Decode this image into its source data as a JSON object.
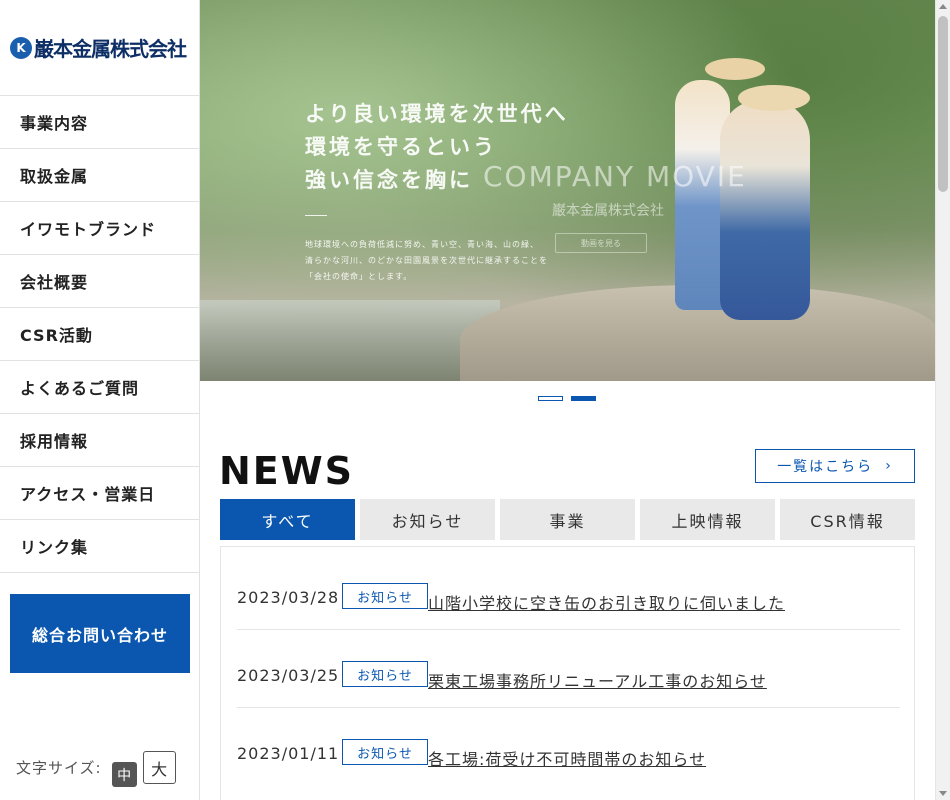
{
  "logo": {
    "mark": "K",
    "text": "巌本金属株式会社"
  },
  "nav": {
    "items": [
      {
        "label": "事業内容"
      },
      {
        "label": "取扱金属"
      },
      {
        "label": "イワモトブランド"
      },
      {
        "label": "会社概要"
      },
      {
        "label": "CSR活動"
      },
      {
        "label": "よくあるご質問"
      },
      {
        "label": "採用情報"
      },
      {
        "label": "アクセス・営業日"
      },
      {
        "label": "リンク集"
      }
    ]
  },
  "contact": {
    "label": "総合お問い合わせ"
  },
  "font_size": {
    "label": "文字サイズ:",
    "mid": "中",
    "big": "大"
  },
  "hero": {
    "copy_line1": "より良い環境を次世代へ",
    "copy_line2": "環境を守るという",
    "copy_line3": "強い信念を胸に",
    "small_line1": "地球環境への負荷低減に努め、青い空、青い海、山の緑、",
    "small_line2": "清らかな河川、のどかな田園風景を次世代に継承することを",
    "small_line3": "「会社の使命」とします。",
    "movie_title": "COMPANY MOVIE",
    "movie_sub": "巌本金属株式会社",
    "movie_button": "動画を見る"
  },
  "slider": {
    "count": 2,
    "active_index": 1
  },
  "news": {
    "title": "NEWS",
    "more_label": "一覧はこちら",
    "tabs": [
      {
        "label": "すべて",
        "active": true
      },
      {
        "label": "お知らせ",
        "active": false
      },
      {
        "label": "事業",
        "active": false
      },
      {
        "label": "上映情報",
        "active": false
      },
      {
        "label": "CSR情報",
        "active": false
      }
    ],
    "items": [
      {
        "date": "2023/03/28",
        "badge": "お知らせ",
        "title": "山階小学校に空き缶のお引き取りに伺いました"
      },
      {
        "date": "2023/03/25",
        "badge": "お知らせ",
        "title": "栗東工場事務所リニューアル工事のお知らせ"
      },
      {
        "date": "2023/01/11",
        "badge": "お知らせ",
        "title": "各工場:荷受け不可時間帯のお知らせ"
      }
    ]
  },
  "colors": {
    "accent": "#0b57b0",
    "logo_text": "#0d2f66",
    "tab_inactive": "#e9e9e9"
  }
}
